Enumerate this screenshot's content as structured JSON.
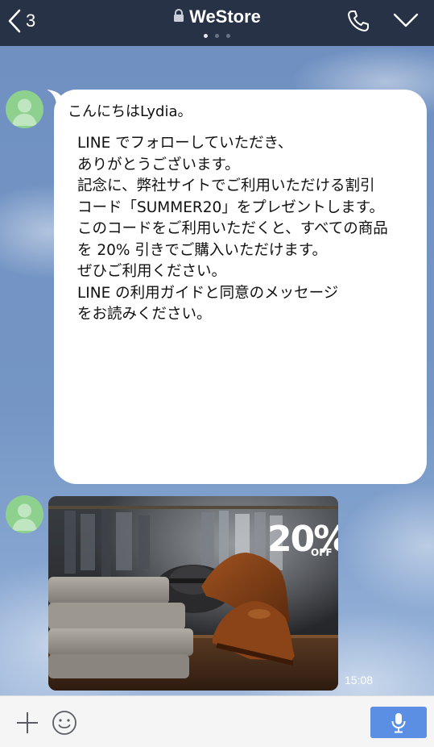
{
  "header": {
    "back_count": "3",
    "title": "WeStore",
    "page_dots": 3,
    "active_dot": 0
  },
  "messages": {
    "greeting": "こんにちはLydia。",
    "body_lines": [
      "LINE でフォローしていただき、",
      "ありがとうございます。",
      "記念に、弊社サイトでご利用いただける割引",
      "コード「SUMMER20」をプレゼントします。",
      "このコードをご利用いただくと、すべての商品",
      "を 20% 引きでご購入いただけます。",
      "ぜひご利用ください。",
      "LINE の利用ガイドと同意のメッセージ",
      "をお読みください。"
    ],
    "promo": {
      "percent": "20%",
      "off": "OFF"
    },
    "timestamp": "15:08"
  },
  "input": {
    "value": "",
    "placeholder": ""
  },
  "colors": {
    "header_bg": "#273247",
    "chat_bg": "#6f90c1",
    "avatar": "#8ed18f",
    "mic_button": "#5a8fe3"
  },
  "icons": {
    "back": "chevron-left-icon",
    "lock": "lock-icon",
    "phone": "phone-icon",
    "menu": "chevron-down-icon",
    "add": "plus-icon",
    "emoji": "smiley-icon",
    "voice": "microphone-icon"
  }
}
